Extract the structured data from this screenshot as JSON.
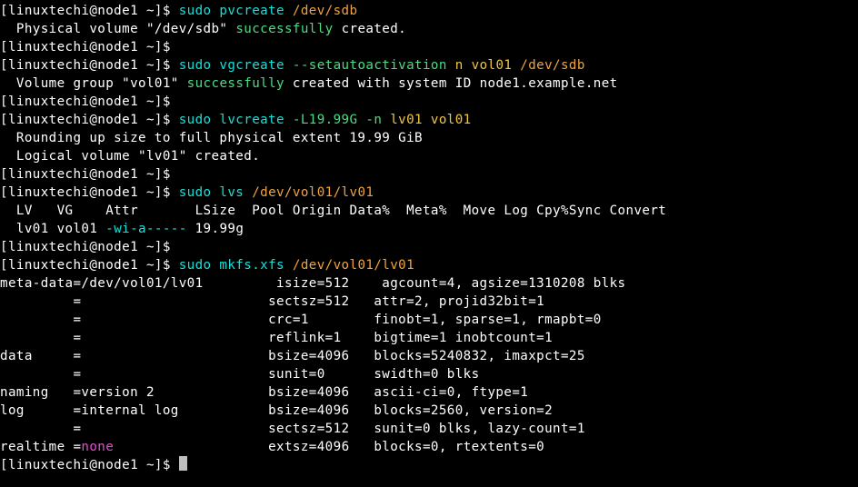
{
  "colors": {
    "white": "c-white",
    "cyan": "c-cyan",
    "green": "c-green",
    "yellow": "c-yellow",
    "orange": "c-orange",
    "magenta": "c-magenta",
    "red": "c-red"
  },
  "lines": [
    {
      "segments": [
        {
          "text": "[linuxtechi@node1 ~]$ ",
          "color": "white"
        },
        {
          "text": "sudo pvcreate ",
          "color": "cyan"
        },
        {
          "text": "/dev/sdb",
          "color": "orange"
        }
      ]
    },
    {
      "segments": [
        {
          "text": "  Physical volume \"/dev/sdb\" ",
          "color": "white"
        },
        {
          "text": "successfully",
          "color": "green"
        },
        {
          "text": " created.",
          "color": "white"
        }
      ]
    },
    {
      "segments": [
        {
          "text": "[linuxtechi@node1 ~]$",
          "color": "white"
        }
      ]
    },
    {
      "segments": [
        {
          "text": "[linuxtechi@node1 ~]$ ",
          "color": "white"
        },
        {
          "text": "sudo vgcreate ",
          "color": "cyan"
        },
        {
          "text": "--setautoactivation",
          "color": "green"
        },
        {
          "text": " n vol01 ",
          "color": "yellow"
        },
        {
          "text": "/dev/sdb",
          "color": "orange"
        }
      ]
    },
    {
      "segments": [
        {
          "text": "  Volume group \"vol01\" ",
          "color": "white"
        },
        {
          "text": "successfully",
          "color": "green"
        },
        {
          "text": " created with system ID node1.example.net",
          "color": "white"
        }
      ]
    },
    {
      "segments": [
        {
          "text": "[linuxtechi@node1 ~]$",
          "color": "white"
        }
      ]
    },
    {
      "segments": [
        {
          "text": "[linuxtechi@node1 ~]$ ",
          "color": "white"
        },
        {
          "text": "sudo lvcreate ",
          "color": "cyan"
        },
        {
          "text": "-L19.99G -n",
          "color": "green"
        },
        {
          "text": " lv01 vol01",
          "color": "yellow"
        }
      ]
    },
    {
      "segments": [
        {
          "text": "  Rounding up size to full physical extent 19.99 GiB",
          "color": "white"
        }
      ]
    },
    {
      "segments": [
        {
          "text": "  Logical volume \"lv01\" created.",
          "color": "white"
        }
      ]
    },
    {
      "segments": [
        {
          "text": "[linuxtechi@node1 ~]$",
          "color": "white"
        }
      ]
    },
    {
      "segments": [
        {
          "text": "[linuxtechi@node1 ~]$ ",
          "color": "white"
        },
        {
          "text": "sudo lvs ",
          "color": "cyan"
        },
        {
          "text": "/dev/vol01/lv01",
          "color": "orange"
        }
      ]
    },
    {
      "segments": [
        {
          "text": "  LV   VG    Attr       LSize  Pool Origin Data%  Meta%  Move Log Cpy%Sync Convert",
          "color": "white"
        }
      ]
    },
    {
      "segments": [
        {
          "text": "  lv01 vol01 ",
          "color": "white"
        },
        {
          "text": "-wi-a-----",
          "color": "cyan"
        },
        {
          "text": " 19.99g",
          "color": "white"
        }
      ]
    },
    {
      "segments": [
        {
          "text": "[linuxtechi@node1 ~]$",
          "color": "white"
        }
      ]
    },
    {
      "segments": [
        {
          "text": "[linuxtechi@node1 ~]$ ",
          "color": "white"
        },
        {
          "text": "sudo mkfs.xfs ",
          "color": "cyan"
        },
        {
          "text": "/dev/vol01/lv01",
          "color": "orange"
        }
      ]
    },
    {
      "segments": [
        {
          "text": "meta-data=/dev/vol01/lv01         isize=512    agcount=4, agsize=1310208 blks",
          "color": "white"
        }
      ]
    },
    {
      "segments": [
        {
          "text": "         =                       sectsz=512   attr=2, projid32bit=1",
          "color": "white"
        }
      ]
    },
    {
      "segments": [
        {
          "text": "         =                       crc=1        finobt=1, sparse=1, rmapbt=0",
          "color": "white"
        }
      ]
    },
    {
      "segments": [
        {
          "text": "         =                       reflink=1    bigtime=1 inobtcount=1",
          "color": "white"
        }
      ]
    },
    {
      "segments": [
        {
          "text": "data     =                       bsize=4096   blocks=5240832, imaxpct=25",
          "color": "white"
        }
      ]
    },
    {
      "segments": [
        {
          "text": "         =                       sunit=0      swidth=0 blks",
          "color": "white"
        }
      ]
    },
    {
      "segments": [
        {
          "text": "naming   =version 2              bsize=4096   ascii-ci=0, ftype=1",
          "color": "white"
        }
      ]
    },
    {
      "segments": [
        {
          "text": "log      =internal log           bsize=4096   blocks=2560, version=2",
          "color": "white"
        }
      ]
    },
    {
      "segments": [
        {
          "text": "         =                       sectsz=512   sunit=0 blks, lazy-count=1",
          "color": "white"
        }
      ]
    },
    {
      "segments": [
        {
          "text": "realtime =",
          "color": "white"
        },
        {
          "text": "none",
          "color": "magenta"
        },
        {
          "text": "                   extsz=4096   blocks=0, rtextents=0",
          "color": "white"
        }
      ]
    },
    {
      "segments": [
        {
          "text": "[linuxtechi@node1 ~]$ ",
          "color": "white"
        }
      ],
      "cursor": true
    }
  ]
}
